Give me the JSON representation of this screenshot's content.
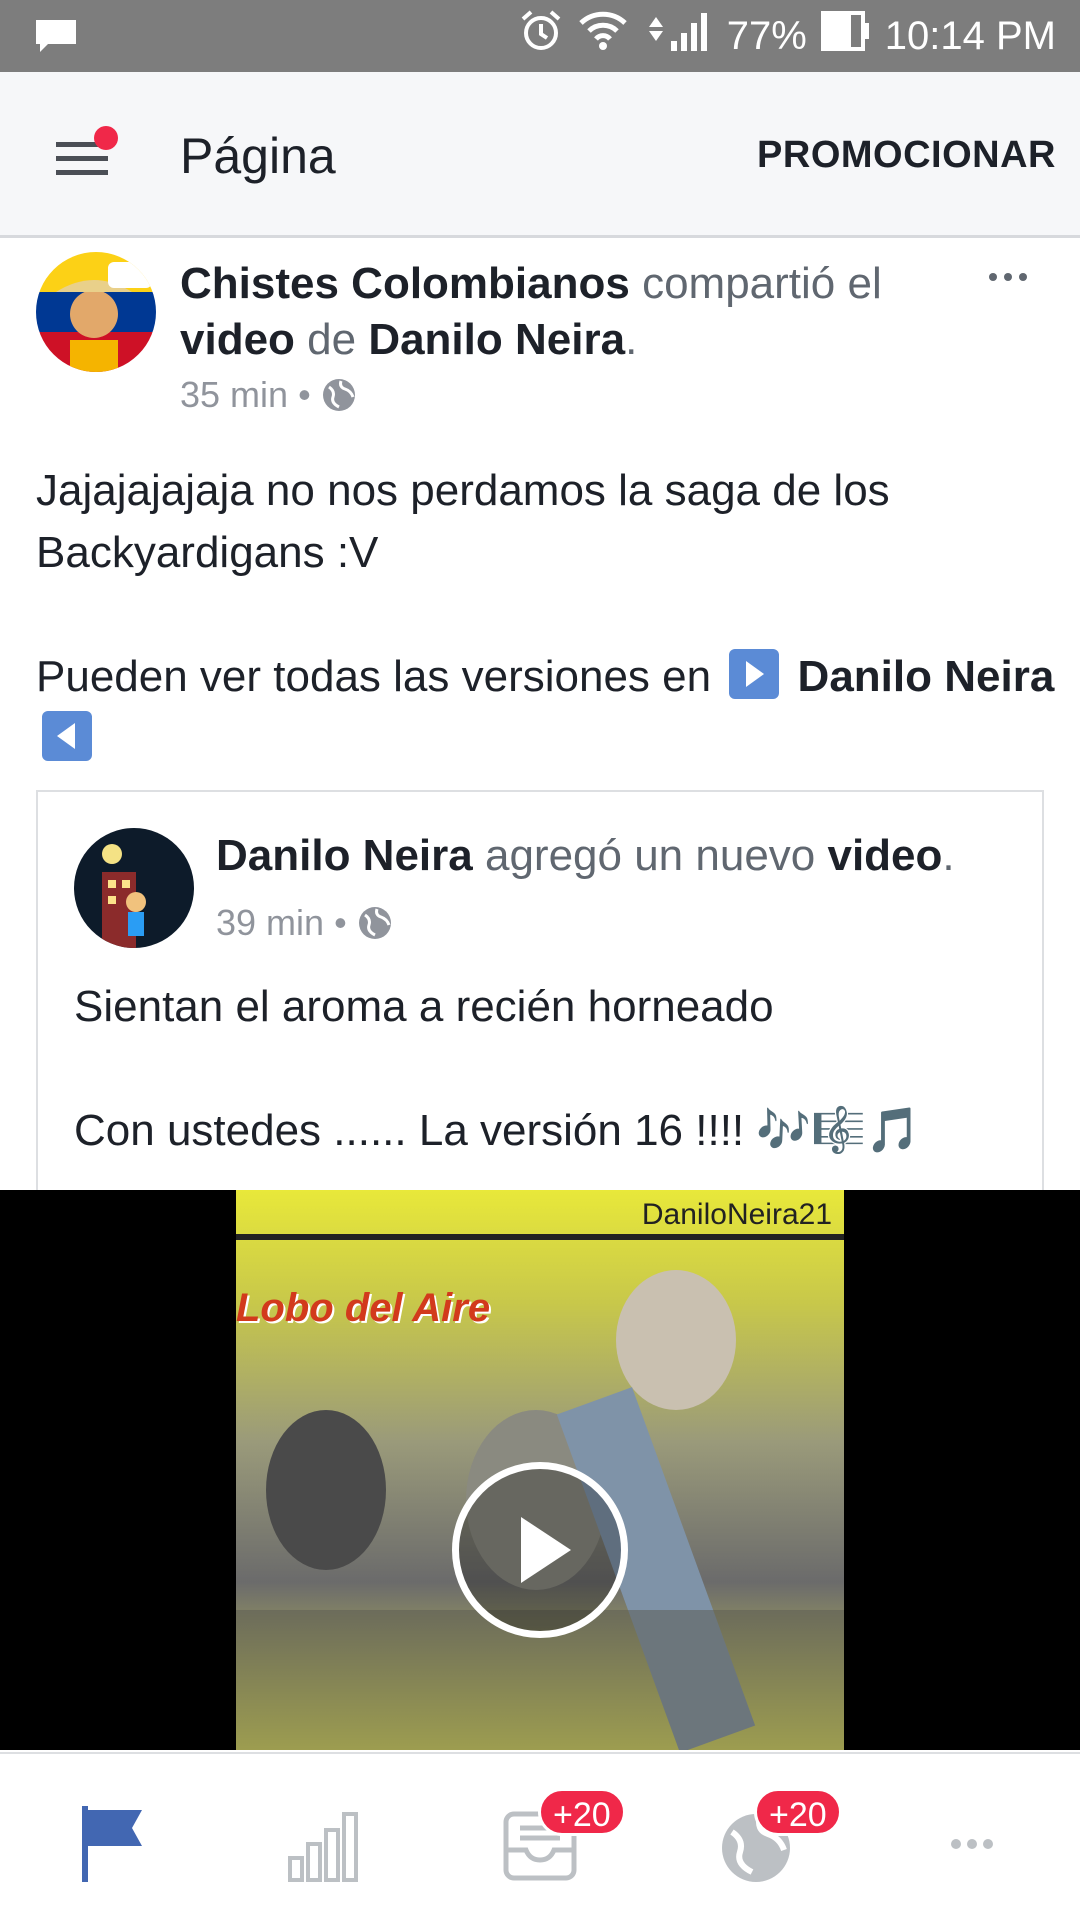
{
  "status_bar": {
    "battery": "77%",
    "time": "10:14 PM",
    "icons": [
      "message-icon",
      "alarm-icon",
      "wifi-icon",
      "signal-icon",
      "battery-icon"
    ]
  },
  "header": {
    "title": "Página",
    "promote_label": "PROMOCIONAR"
  },
  "post": {
    "page_name": "Chistes Colombianos",
    "action_text": " compartió el ",
    "object_label": "video",
    "of_text": " de ",
    "source_name": "Danilo Neira",
    "period": ".",
    "time": "35 min",
    "dot": "•",
    "text_line1": "Jajajajajaja no nos perdamos la saga de los Backyardigans  :V",
    "text_line2_prefix": "Pueden ver todas las versiones en ",
    "text_link": "Danilo Neira"
  },
  "shared": {
    "author": "Danilo Neira",
    "action_text": " agregó un nuevo ",
    "object_label": "video",
    "period": ".",
    "time": "39 min",
    "dot": "•",
    "text_line1": "Sientan el aroma a recién horneado",
    "text_line2": "Con ustedes ...... La versión 16 !!!!  🎶🎼🎵"
  },
  "video": {
    "watermark": "DaniloNeira21",
    "overlay_title": "Lobo del Aire"
  },
  "bottom_nav": {
    "items": [
      {
        "name": "page",
        "active": true
      },
      {
        "name": "insights"
      },
      {
        "name": "inbox",
        "badge": "+20"
      },
      {
        "name": "notifications",
        "badge": "+20"
      },
      {
        "name": "more"
      }
    ]
  },
  "colors": {
    "accent": "#4267b2",
    "badge": "#f02849",
    "status_bar": "#7d7d7d",
    "muted_text": "#90949c"
  }
}
